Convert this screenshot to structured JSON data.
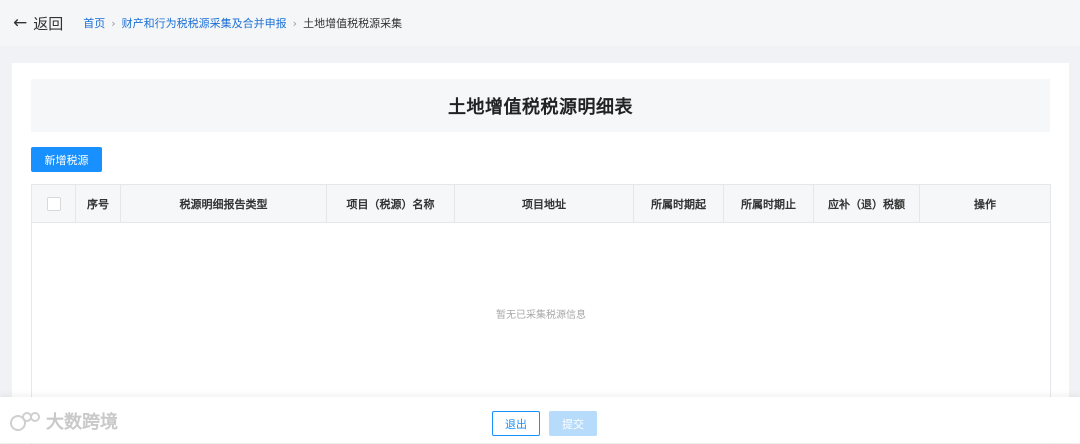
{
  "nav": {
    "back_label": "返回",
    "breadcrumbs": [
      {
        "label": "首页"
      },
      {
        "label": "财产和行为税税源采集及合并申报"
      },
      {
        "label": "土地增值税税源采集"
      }
    ]
  },
  "main": {
    "title": "土地增值税税源明细表",
    "add_button": "新增税源",
    "table": {
      "columns": [
        "序号",
        "税源明细报告类型",
        "项目（税源）名称",
        "项目地址",
        "所属时期起",
        "所属时期止",
        "应补（退）税额",
        "操作"
      ],
      "empty_text": "暂无已采集税源信息"
    }
  },
  "footer": {
    "exit_label": "退出",
    "submit_label": "提交"
  },
  "watermark": {
    "text": "大数跨境"
  },
  "colors": {
    "primary": "#1890ff",
    "link": "#1a6fd6",
    "disabled": "#b7dbfb"
  }
}
